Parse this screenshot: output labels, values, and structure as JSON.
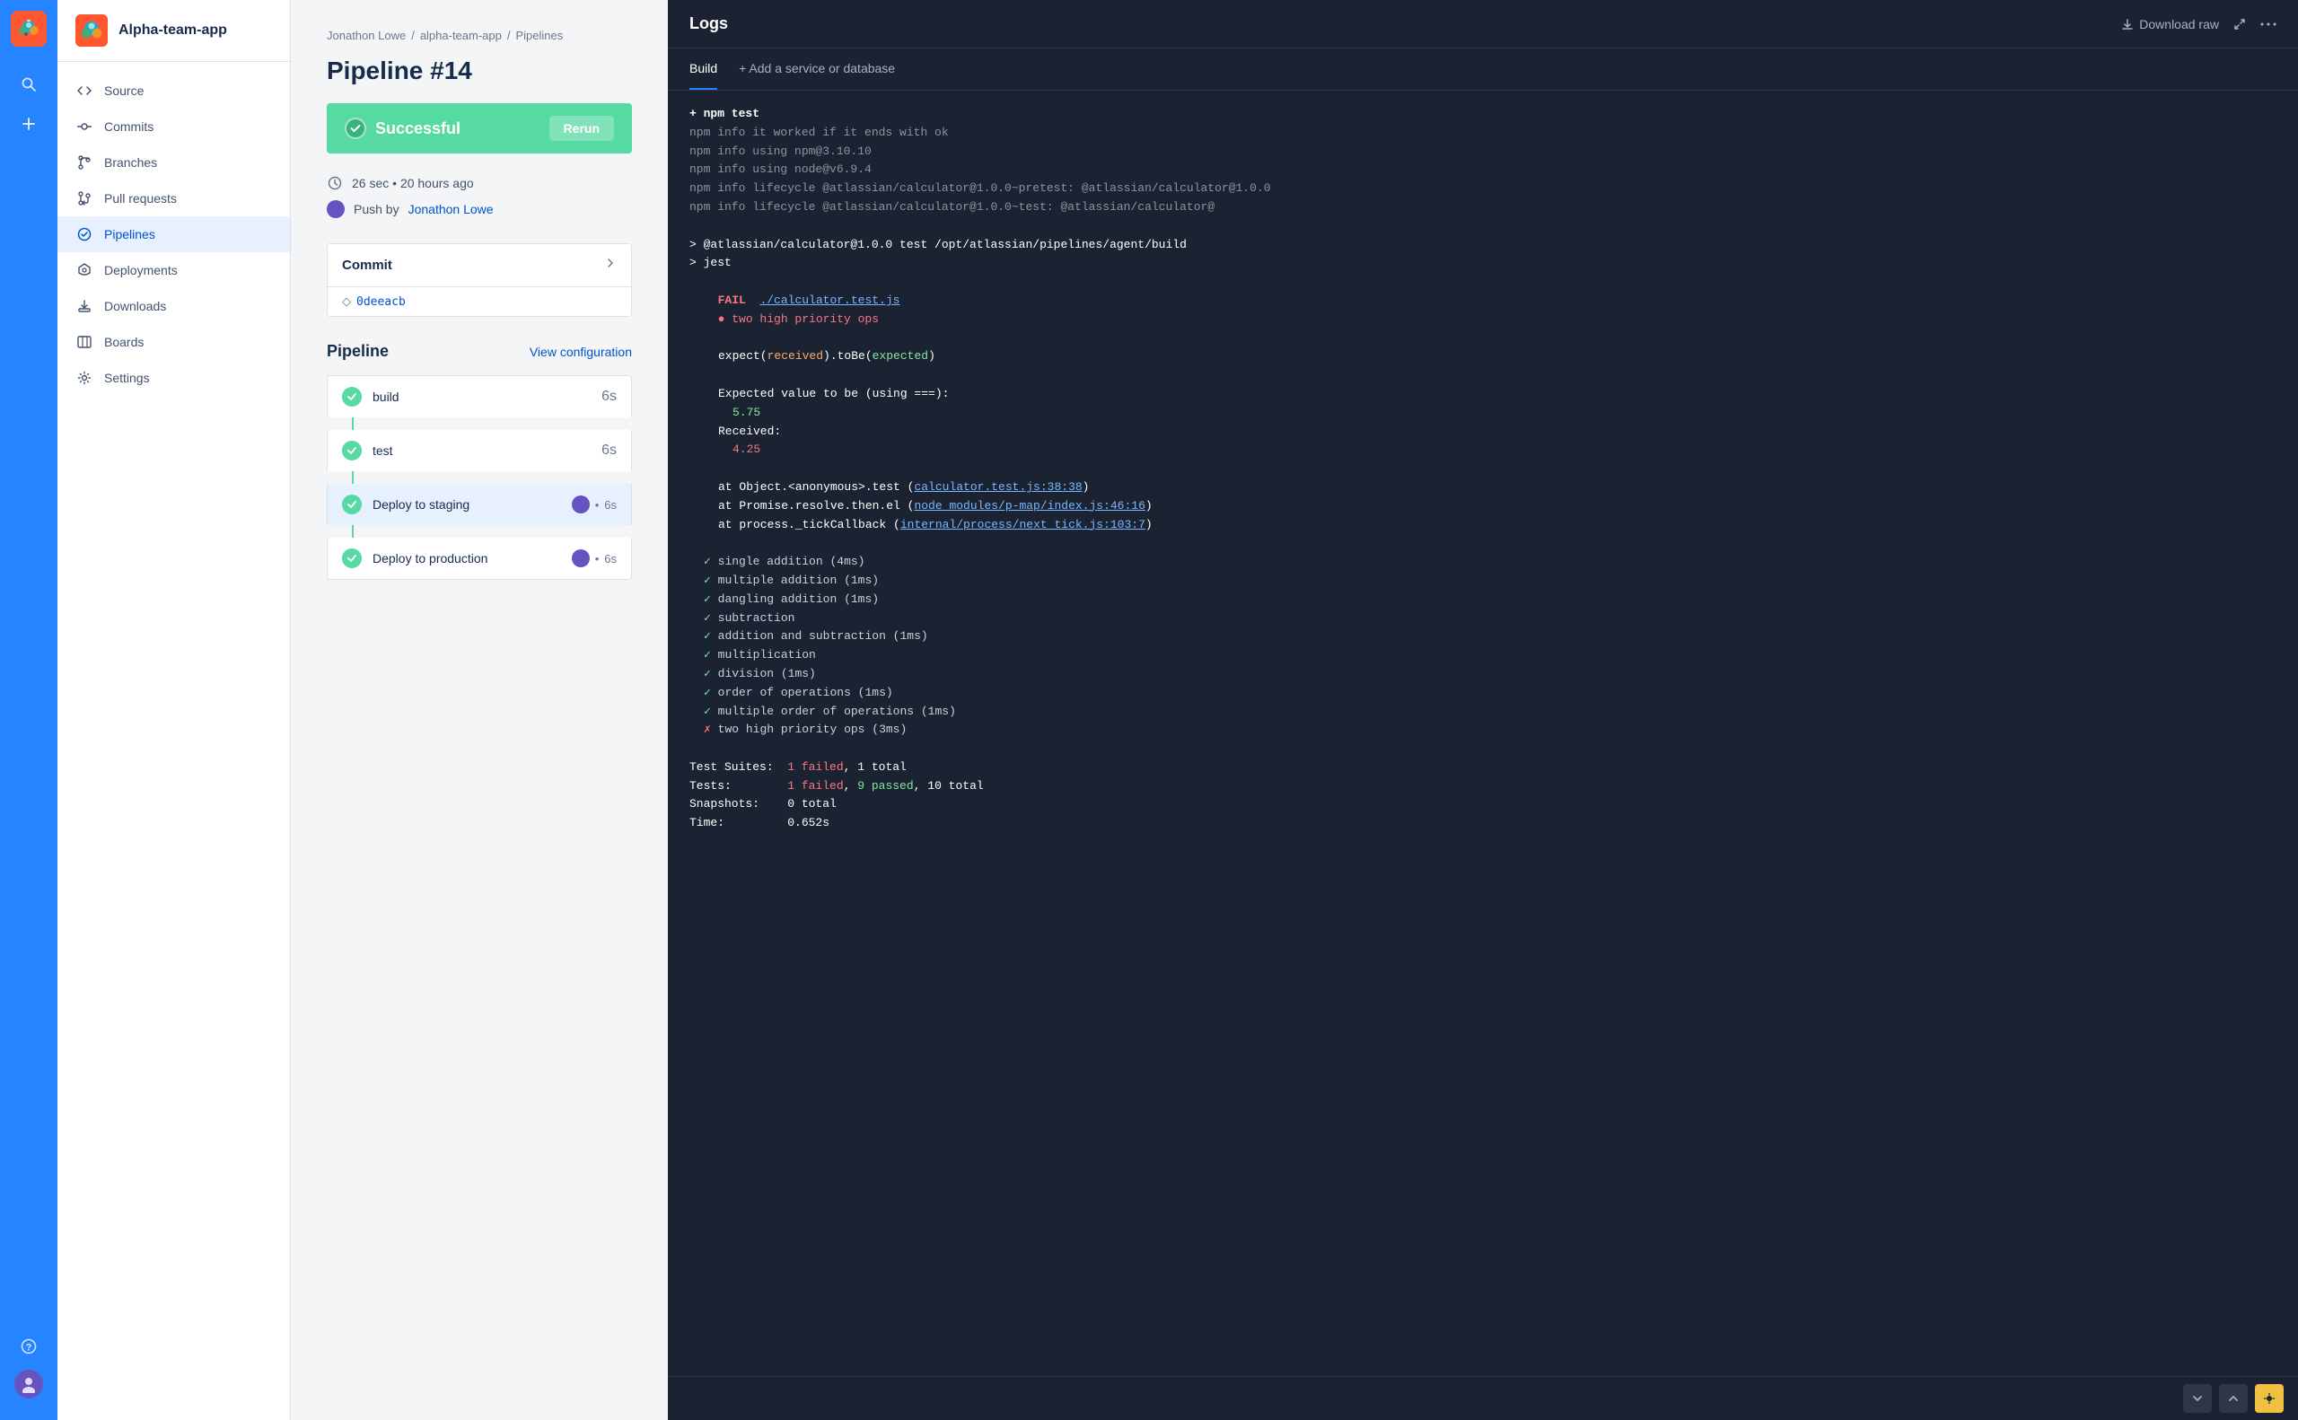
{
  "iconBar": {
    "appName": "Alpha-team-app"
  },
  "sidebar": {
    "appName": "Alpha-team-app",
    "navItems": [
      {
        "id": "source",
        "label": "Source",
        "icon": "code"
      },
      {
        "id": "commits",
        "label": "Commits",
        "icon": "commits"
      },
      {
        "id": "branches",
        "label": "Branches",
        "icon": "branches"
      },
      {
        "id": "pull-requests",
        "label": "Pull requests",
        "icon": "pull-requests"
      },
      {
        "id": "pipelines",
        "label": "Pipelines",
        "icon": "pipelines",
        "active": true
      },
      {
        "id": "deployments",
        "label": "Deployments",
        "icon": "deployments"
      },
      {
        "id": "downloads",
        "label": "Downloads",
        "icon": "downloads"
      },
      {
        "id": "boards",
        "label": "Boards",
        "icon": "boards"
      },
      {
        "id": "settings",
        "label": "Settings",
        "icon": "settings"
      }
    ]
  },
  "breadcrumb": {
    "items": [
      "Jonathon Lowe",
      "alpha-team-app",
      "Pipelines"
    ]
  },
  "pipeline": {
    "title": "Pipeline #14",
    "status": "Successful",
    "rerunLabel": "Rerun",
    "duration": "26 sec",
    "timeAgo": "20 hours ago",
    "pushedBy": "Push by",
    "author": "Jonathon Lowe",
    "commitLabel": "Commit",
    "commitHash": "0deeacb",
    "pipelineLabel": "Pipeline",
    "viewConfigLabel": "View configuration",
    "steps": [
      {
        "id": "build",
        "name": "build",
        "time": "6s",
        "hasAvatar": false
      },
      {
        "id": "test",
        "name": "test",
        "time": "6s",
        "hasAvatar": false
      },
      {
        "id": "deploy-staging",
        "name": "Deploy to staging",
        "time": "6s",
        "hasAvatar": true,
        "active": true
      },
      {
        "id": "deploy-production",
        "name": "Deploy to production",
        "time": "6s",
        "hasAvatar": true
      }
    ]
  },
  "logs": {
    "title": "Logs",
    "downloadRaw": "Download raw",
    "tabs": [
      {
        "id": "build",
        "label": "Build",
        "active": true
      },
      {
        "id": "add-service",
        "label": "+ Add a service or database"
      }
    ],
    "lines": [
      {
        "text": "+ npm test",
        "style": "white bold"
      },
      {
        "text": "npm info it worked if it ends with ok",
        "style": "dim"
      },
      {
        "text": "npm info using npm@3.10.10",
        "style": "dim"
      },
      {
        "text": "npm info using node@v6.9.4",
        "style": "dim"
      },
      {
        "text": "npm info lifecycle @atlassian/calculator@1.0.0~pretest: @atlassian/calculator@1.0.0",
        "style": "dim"
      },
      {
        "text": "npm info lifecycle @atlassian/calculator@1.0.0~test: @atlassian/calculator@",
        "style": "dim"
      },
      {
        "text": "",
        "style": ""
      },
      {
        "text": "> @atlassian/calculator@1.0.0 test /opt/atlassian/pipelines/agent/build",
        "style": "white"
      },
      {
        "text": "> jest",
        "style": "white"
      },
      {
        "text": "",
        "style": ""
      },
      {
        "text": "  FAIL  ./calculator.test.js",
        "style": "red bold"
      },
      {
        "text": "  ● two high priority ops",
        "style": "red indent"
      },
      {
        "text": "",
        "style": ""
      },
      {
        "text": "    expect(received).toBe(expected)",
        "style": "white indent2"
      },
      {
        "text": "",
        "style": ""
      },
      {
        "text": "    Expected value to be (using ===):",
        "style": "white indent2"
      },
      {
        "text": "      5.75",
        "style": "green indent2"
      },
      {
        "text": "    Received:",
        "style": "white indent2"
      },
      {
        "text": "      4.25",
        "style": "red indent2"
      },
      {
        "text": "",
        "style": ""
      },
      {
        "text": "    at Object.<anonymous>.test (calculator.test.js:38:38)",
        "style": "white indent2"
      },
      {
        "text": "    at Promise.resolve.then.el (node_modules/p-map/index.js:46:16)",
        "style": "white indent2"
      },
      {
        "text": "    at process._tickCallback (internal/process/next_tick.js:103:7)",
        "style": "white indent2"
      },
      {
        "text": "",
        "style": ""
      },
      {
        "text": "  ✓ single addition (4ms)",
        "style": "green indent"
      },
      {
        "text": "  ✓ multiple addition (1ms)",
        "style": "green indent"
      },
      {
        "text": "  ✓ dangling addition (1ms)",
        "style": "green indent"
      },
      {
        "text": "  ✓ subtraction",
        "style": "green indent"
      },
      {
        "text": "  ✓ addition and subtraction (1ms)",
        "style": "green indent"
      },
      {
        "text": "  ✓ multiplication",
        "style": "green indent"
      },
      {
        "text": "  ✓ division (1ms)",
        "style": "green indent"
      },
      {
        "text": "  ✓ order of operations (1ms)",
        "style": "green indent"
      },
      {
        "text": "  ✓ multiple order of operations (1ms)",
        "style": "green indent"
      },
      {
        "text": "  ✗ two high priority ops (3ms)",
        "style": "red indent"
      },
      {
        "text": "",
        "style": ""
      },
      {
        "text": "Test Suites:  1 failed, 1 total",
        "style": "white"
      },
      {
        "text": "Tests:        1 failed, 9 passed, 10 total",
        "style": "white"
      },
      {
        "text": "Snapshots:    0 total",
        "style": "white"
      },
      {
        "text": "Time:         0.652s",
        "style": "white"
      }
    ]
  }
}
